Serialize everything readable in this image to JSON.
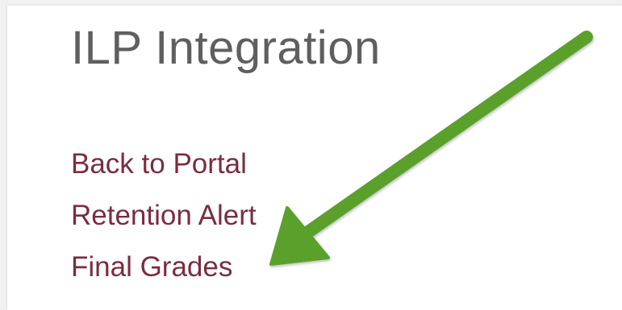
{
  "header": {
    "title": "ILP Integration"
  },
  "nav": {
    "items": [
      {
        "label": "Back to Portal"
      },
      {
        "label": "Retention Alert"
      },
      {
        "label": "Final Grades"
      }
    ]
  },
  "colors": {
    "background": "#f1f1f1",
    "panel": "#ffffff",
    "title_text": "#5f5f5f",
    "link_text": "#7a2d3f",
    "annotation_arrow": "#5aa02c"
  },
  "annotation": {
    "icon": "arrow-icon",
    "points_to": "Final Grades"
  }
}
